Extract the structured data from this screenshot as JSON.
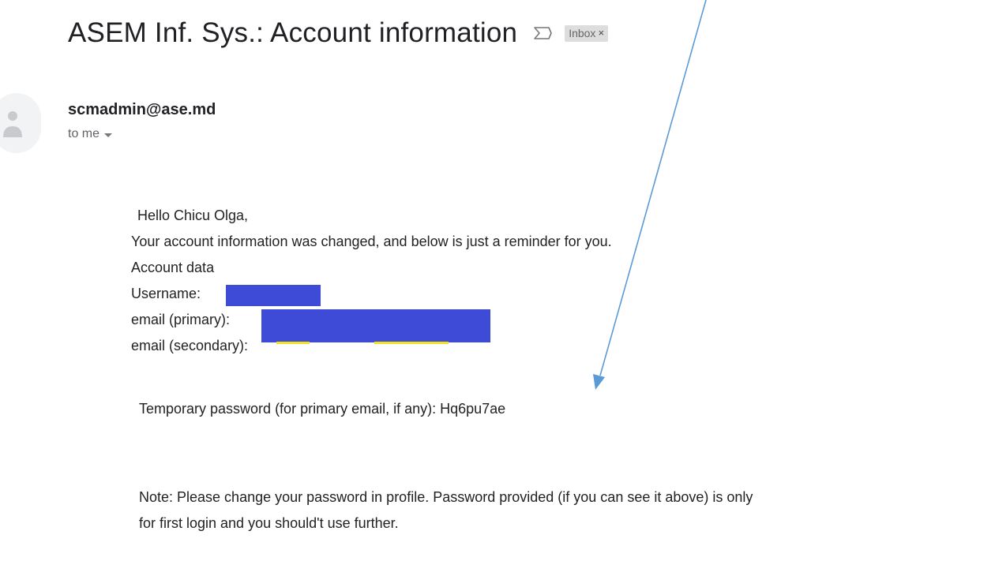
{
  "email": {
    "subject": "ASEM Inf. Sys.: Account information",
    "label_chip": "Inbox",
    "label_chip_close": "×",
    "sender": "scmadmin@ase.md",
    "recipient": "to me",
    "greeting": "Hello Chicu Olga,",
    "line_changed": "Your account information was changed, and below is just a reminder for you.",
    "account_data_heading": "Account data",
    "username_label": "Username:",
    "email_primary_label": "email (primary):",
    "email_secondary_label": "email (secondary):",
    "temp_password_line": "Temporary password (for primary email, if any): Hq6pu7ae",
    "note_line_1": "Note: Please change your password in profile. Password provided (if you can see it above) is only",
    "note_line_2": "for first login and you should't use further."
  },
  "icons": {
    "important": "sigma-important-icon",
    "avatar": "person-avatar-icon",
    "recipient_toggle": "chevron-down-icon",
    "annotation": "arrow-annotation"
  },
  "colors": {
    "redaction": "#3d4bd6",
    "annotation_arrow": "#5b9bd5",
    "highlight": "#f4e31a"
  }
}
